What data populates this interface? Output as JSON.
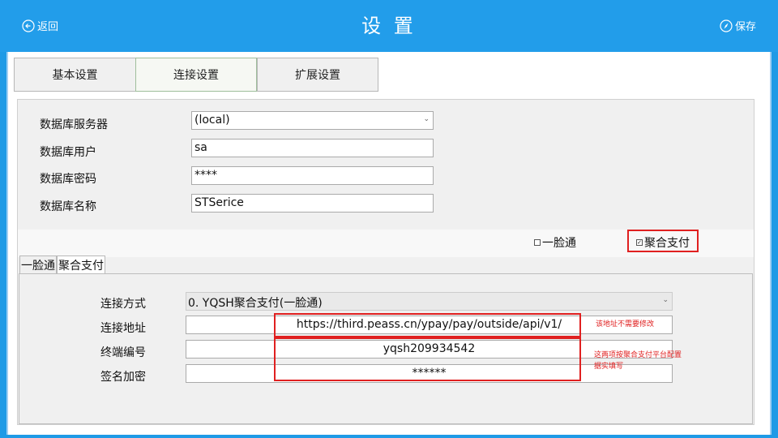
{
  "header": {
    "back_label": "返回",
    "title": "设 置",
    "save_label": "保存"
  },
  "tabs": [
    {
      "label": "基本设置",
      "active": false
    },
    {
      "label": "连接设置",
      "active": true
    },
    {
      "label": "扩展设置",
      "active": false
    }
  ],
  "db": {
    "server_label": "数据库服务器",
    "server_value": "(local)",
    "user_label": "数据库用户",
    "user_value": "sa",
    "password_label": "数据库密码",
    "password_value": "****",
    "name_label": "数据库名称",
    "name_value": "STSerice"
  },
  "checkboxes": [
    {
      "label": "一脸通",
      "checked": false
    },
    {
      "label": "聚合支付",
      "checked": true
    }
  ],
  "subtabs": [
    {
      "label": "一脸通",
      "active": false
    },
    {
      "label": "聚合支付",
      "active": true
    }
  ],
  "pay": {
    "mode_label": "连接方式",
    "mode_value": "0. YQSH聚合支付(一脸通)",
    "url_label": "连接地址",
    "url_value": "https://third.peass.cn/ypay/pay/outside/api/v1/",
    "terminal_label": "终端编号",
    "terminal_value": "yqsh209934542",
    "sign_label": "签名加密",
    "sign_value": "******"
  },
  "annotations": {
    "url_note": "该地址不需要修改",
    "config_note_line1": "这两项按聚合支付平台配置",
    "config_note_line2": "据实填写"
  },
  "colors": {
    "header_bg": "#229dea",
    "highlight": "#e02020"
  },
  "icons": {
    "back": "back-arrow-circle-icon",
    "save": "save-compass-icon",
    "dropdown": "chevron-down-icon"
  }
}
